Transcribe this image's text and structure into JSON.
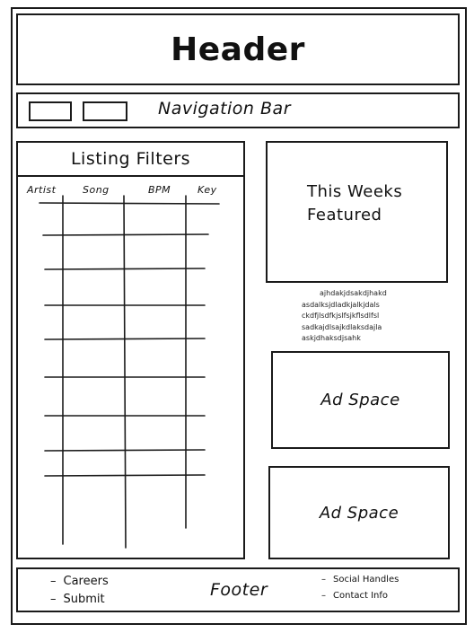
{
  "header": {
    "title": "Header"
  },
  "nav": {
    "title": "Navigation Bar"
  },
  "listing": {
    "title": "Listing Filters",
    "columns": [
      "Artist",
      "Song",
      "BPM",
      "Key"
    ]
  },
  "featured": {
    "line1": "This Weeks",
    "line2": "Featured"
  },
  "blurb": {
    "lines": [
      "ajhdakjdsakdjhakd",
      "asdalksjdladkjalkjdals",
      "ckdfjlsdfkjslfsjkflsdlfsl",
      "sadkajdlsajkdlaksdajla",
      "askjdhaksdjsahk"
    ]
  },
  "ads": {
    "ad1": "Ad Space",
    "ad2": "Ad Space"
  },
  "footer": {
    "title": "Footer",
    "left": [
      "Careers",
      "Submit"
    ],
    "right": [
      "Social Handles",
      "Contact Info"
    ]
  }
}
